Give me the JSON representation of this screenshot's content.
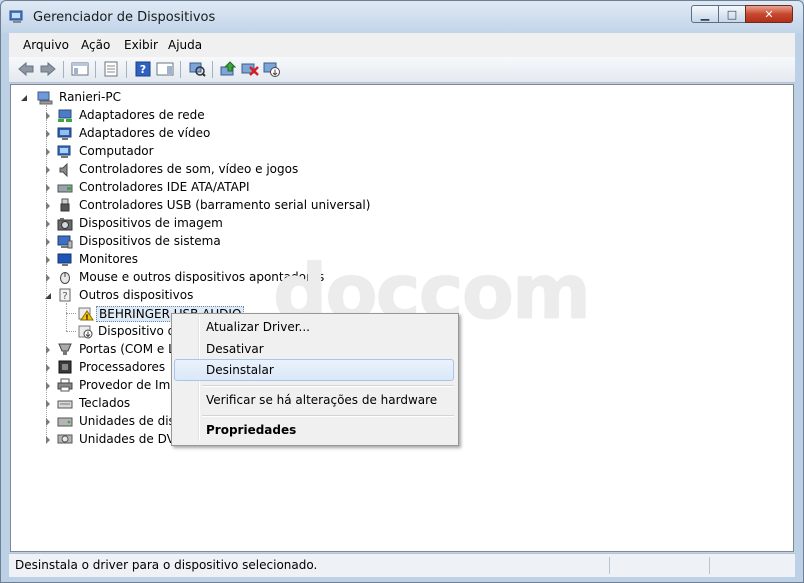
{
  "window": {
    "title": "Gerenciador de Dispositivos",
    "min_glyph": "▁",
    "max_glyph": "□",
    "close_glyph": "✕"
  },
  "menubar": [
    "Arquivo",
    "Ação",
    "Exibir",
    "Ajuda"
  ],
  "tree": {
    "root": "Ranieri-PC",
    "categories": [
      {
        "label": "Adaptadores de rede",
        "icon": "network-adapter-icon"
      },
      {
        "label": "Adaptadores de vídeo",
        "icon": "display-adapter-icon"
      },
      {
        "label": "Computador",
        "icon": "computer-icon"
      },
      {
        "label": "Controladores de som, vídeo e jogos",
        "icon": "speaker-icon"
      },
      {
        "label": "Controladores IDE ATA/ATAPI",
        "icon": "ide-controller-icon"
      },
      {
        "label": "Controladores USB (barramento serial universal)",
        "icon": "usb-icon"
      },
      {
        "label": "Dispositivos de imagem",
        "icon": "camera-icon"
      },
      {
        "label": "Dispositivos de sistema",
        "icon": "system-device-icon"
      },
      {
        "label": "Monitores",
        "icon": "monitor-icon"
      },
      {
        "label": "Mouse e outros dispositivos apontadores",
        "icon": "mouse-icon"
      },
      {
        "label": "Outros dispositivos",
        "icon": "unknown-device-icon"
      }
    ],
    "other_devices": [
      {
        "label": "BEHRINGER USB AUDIO",
        "icon": "warning-icon"
      },
      {
        "label": "Dispositivo de",
        "icon": "download-device-icon"
      }
    ],
    "categories_after": [
      {
        "label": "Portas (COM e LP",
        "icon": "port-icon"
      },
      {
        "label": "Processadores",
        "icon": "processor-icon"
      },
      {
        "label": "Provedor de Impr",
        "icon": "printer-icon"
      },
      {
        "label": "Teclados",
        "icon": "keyboard-icon"
      },
      {
        "label": "Unidades de disco",
        "icon": "disk-drive-icon"
      },
      {
        "label": "Unidades de DVD",
        "icon": "dvd-drive-icon"
      }
    ]
  },
  "context_menu": {
    "items": [
      "Atualizar Driver...",
      "Desativar",
      "Desinstalar",
      "Verificar se há alterações de hardware",
      "Propriedades"
    ]
  },
  "watermark": "doccom",
  "status": "Desinstala o driver para o dispositivo selecionado.",
  "colors": {
    "selection": "#dfeaf7",
    "close_button": "#c8492f",
    "warning": "#f5c400"
  }
}
